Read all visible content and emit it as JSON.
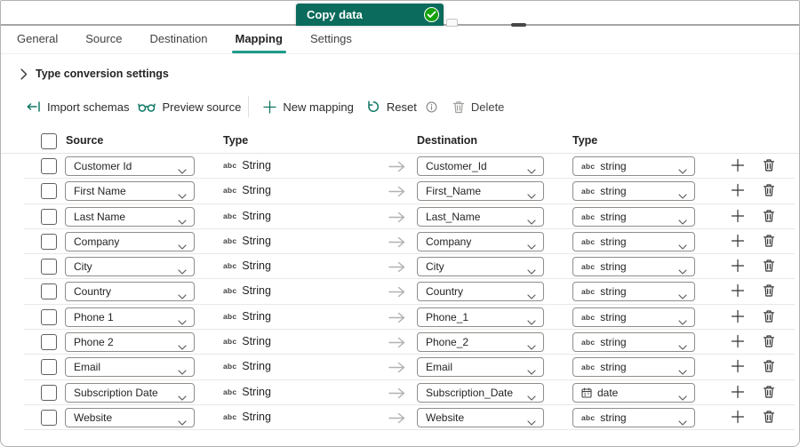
{
  "colors": {
    "accent_teal": "#117865",
    "tab_underline": "#1e9a8a",
    "activity_green": "#0b6b5c",
    "status_green": "#15a10e",
    "disabled_grey": "#a19f9d"
  },
  "canvas": {
    "activity_label": "Copy data",
    "status_icon": "checkmark-success"
  },
  "tabs": [
    {
      "label": "General",
      "active": false
    },
    {
      "label": "Source",
      "active": false
    },
    {
      "label": "Destination",
      "active": false
    },
    {
      "label": "Mapping",
      "active": true
    },
    {
      "label": "Settings",
      "active": false
    }
  ],
  "type_conversion": {
    "label": "Type conversion settings",
    "state": "collapsed"
  },
  "toolbar": {
    "import_schemas": "Import schemas",
    "preview_source": "Preview source",
    "new_mapping": "New mapping",
    "reset": "Reset",
    "delete": "Delete"
  },
  "icons": {
    "abc_label": "abc"
  },
  "table": {
    "headers": {
      "source": "Source",
      "source_type": "Type",
      "destination": "Destination",
      "destination_type": "Type"
    },
    "rows": [
      {
        "source": "Customer Id",
        "source_type": "String",
        "destination": "Customer_Id",
        "dest_type": "string",
        "dest_type_icon": "abc"
      },
      {
        "source": "First Name",
        "source_type": "String",
        "destination": "First_Name",
        "dest_type": "string",
        "dest_type_icon": "abc"
      },
      {
        "source": "Last Name",
        "source_type": "String",
        "destination": "Last_Name",
        "dest_type": "string",
        "dest_type_icon": "abc"
      },
      {
        "source": "Company",
        "source_type": "String",
        "destination": "Company",
        "dest_type": "string",
        "dest_type_icon": "abc"
      },
      {
        "source": "City",
        "source_type": "String",
        "destination": "City",
        "dest_type": "string",
        "dest_type_icon": "abc"
      },
      {
        "source": "Country",
        "source_type": "String",
        "destination": "Country",
        "dest_type": "string",
        "dest_type_icon": "abc"
      },
      {
        "source": "Phone 1",
        "source_type": "String",
        "destination": "Phone_1",
        "dest_type": "string",
        "dest_type_icon": "abc"
      },
      {
        "source": "Phone 2",
        "source_type": "String",
        "destination": "Phone_2",
        "dest_type": "string",
        "dest_type_icon": "abc"
      },
      {
        "source": "Email",
        "source_type": "String",
        "destination": "Email",
        "dest_type": "string",
        "dest_type_icon": "abc"
      },
      {
        "source": "Subscription Date",
        "source_type": "String",
        "destination": "Subscription_Date",
        "dest_type": "date",
        "dest_type_icon": "calendar"
      },
      {
        "source": "Website",
        "source_type": "String",
        "destination": "Website",
        "dest_type": "string",
        "dest_type_icon": "abc"
      }
    ]
  }
}
